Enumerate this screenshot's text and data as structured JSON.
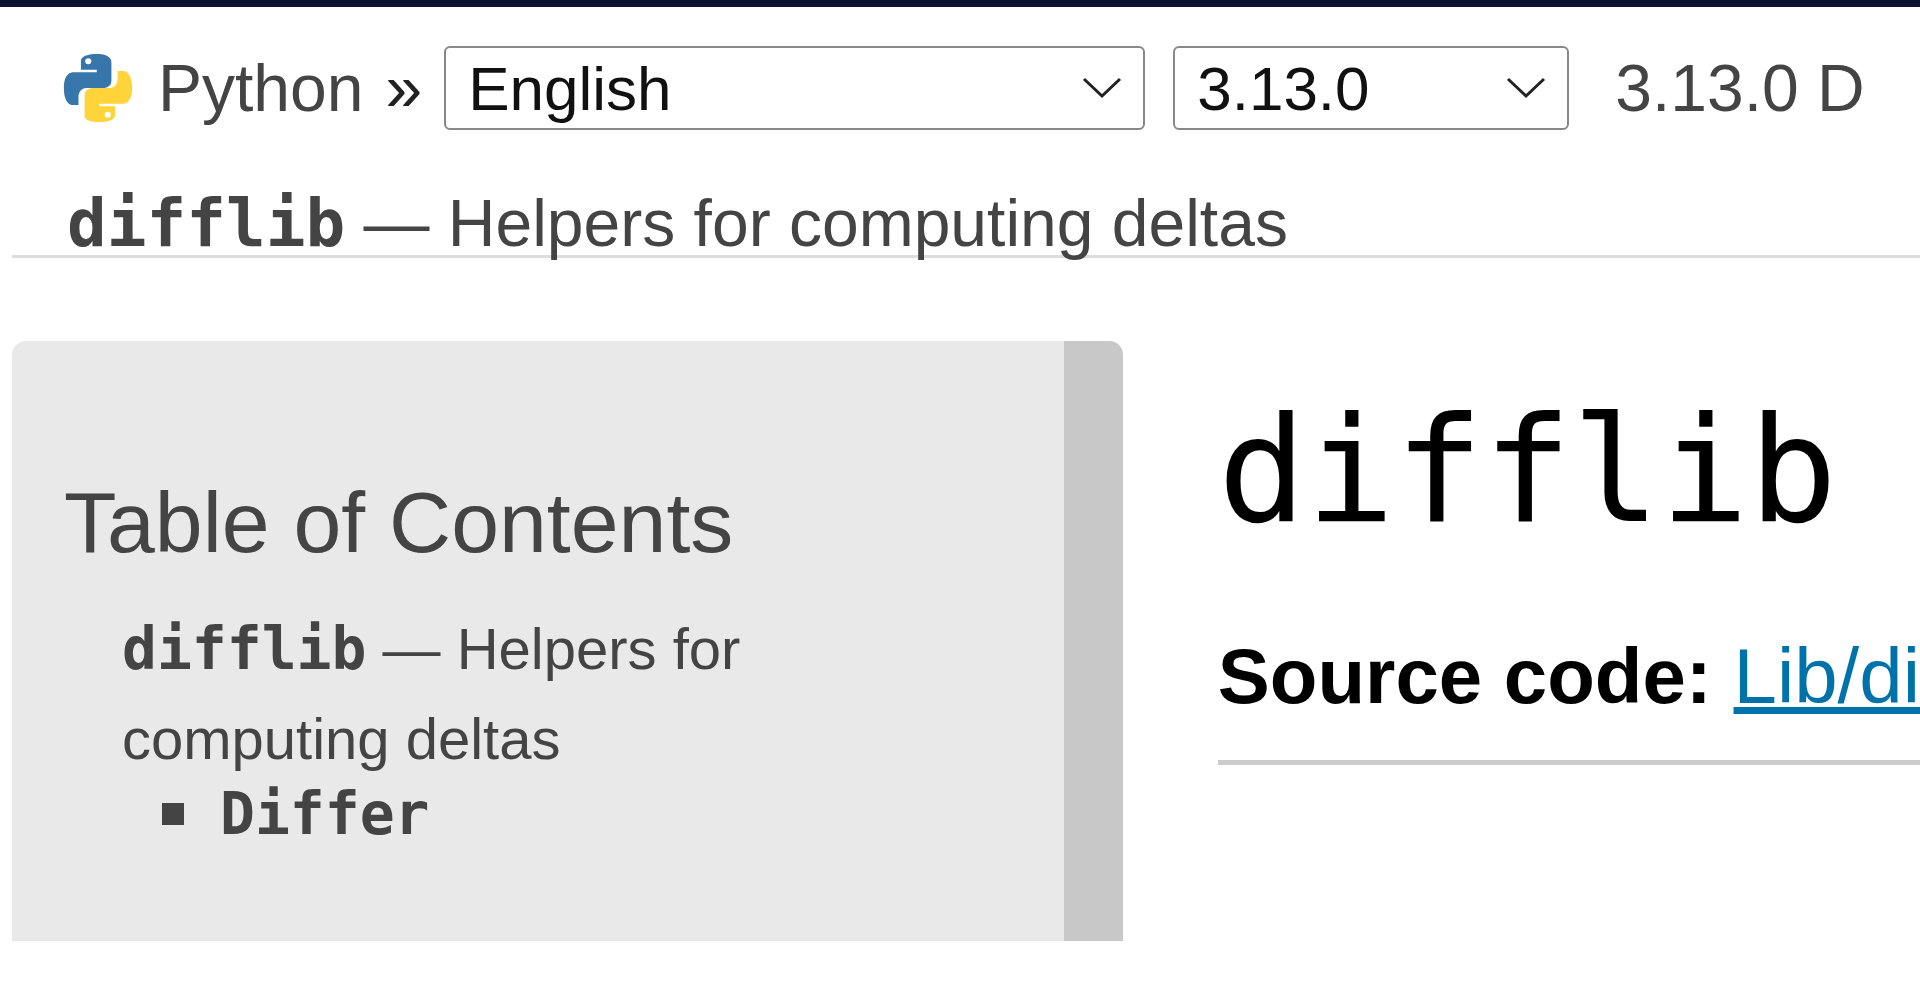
{
  "header": {
    "home": "Python",
    "separator": "»",
    "language": {
      "value": "English"
    },
    "version": {
      "value": "3.13.0"
    },
    "doc_title": "3.13.0 D"
  },
  "breadcrumb": {
    "module": "difflib",
    "rest": "— Helpers for computing deltas"
  },
  "sidebar": {
    "title": "Table of Contents",
    "items": [
      {
        "module": "difflib",
        "rest": "— Helpers for computing deltas",
        "children": [
          {
            "module": "Differ"
          }
        ]
      }
    ]
  },
  "content": {
    "title": "difflib",
    "source_label": "Source code:",
    "source_link": "Lib/di"
  }
}
